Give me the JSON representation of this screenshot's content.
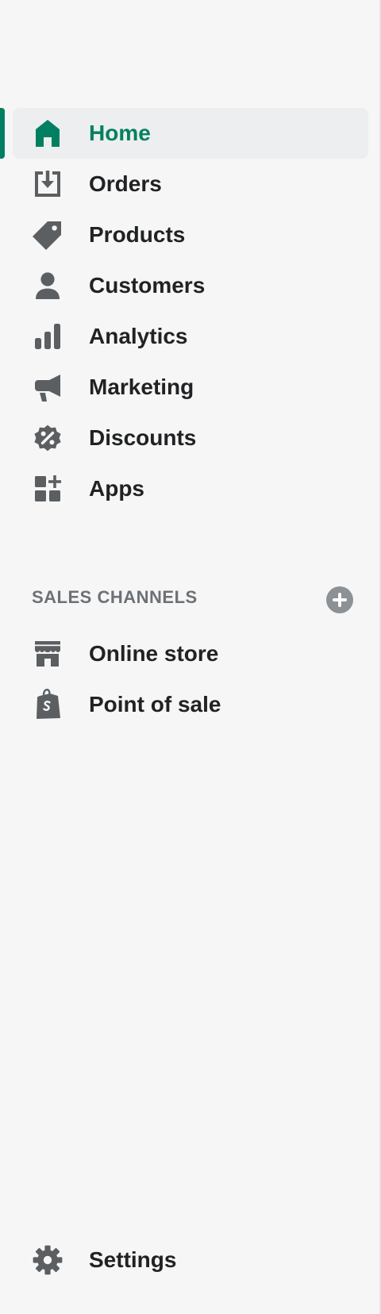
{
  "nav": {
    "items": [
      {
        "label": "Home",
        "icon": "home-icon",
        "active": true
      },
      {
        "label": "Orders",
        "icon": "orders-icon"
      },
      {
        "label": "Products",
        "icon": "tag-icon"
      },
      {
        "label": "Customers",
        "icon": "person-icon"
      },
      {
        "label": "Analytics",
        "icon": "bar-chart-icon"
      },
      {
        "label": "Marketing",
        "icon": "megaphone-icon"
      },
      {
        "label": "Discounts",
        "icon": "discount-badge-icon"
      },
      {
        "label": "Apps",
        "icon": "apps-grid-icon"
      }
    ]
  },
  "sales_channels": {
    "header": "SALES CHANNELS",
    "add_icon": "plus-circle-icon",
    "items": [
      {
        "label": "Online store",
        "icon": "storefront-icon"
      },
      {
        "label": "Point of sale",
        "icon": "shopping-bag-icon"
      }
    ]
  },
  "footer": {
    "settings": {
      "label": "Settings",
      "icon": "gear-icon"
    }
  },
  "colors": {
    "accent": "#008060",
    "icon": "#5c5f62",
    "text": "#202223",
    "muted": "#6d7175",
    "background": "#f6f6f7",
    "active_background": "#edeeef"
  }
}
